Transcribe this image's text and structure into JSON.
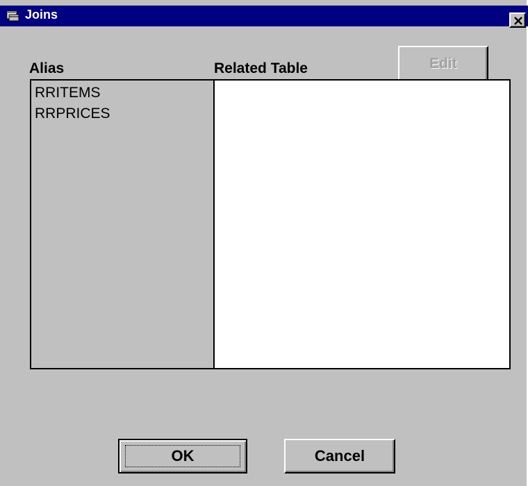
{
  "window": {
    "title": "Joins",
    "title_icon": "table-icon",
    "close_icon": "close-icon"
  },
  "headers": {
    "alias": "Alias",
    "related_table": "Related Table"
  },
  "toolbar": {
    "edit_label": "Edit",
    "edit_enabled": false
  },
  "joins": {
    "aliases": [
      "RRITEMS",
      "RRPRICES"
    ]
  },
  "buttons": {
    "ok_label": "OK",
    "cancel_label": "Cancel"
  },
  "colors": {
    "titlebar": "#000080",
    "face": "#c0c0c0",
    "disabled_text": "#a0a0a0"
  }
}
